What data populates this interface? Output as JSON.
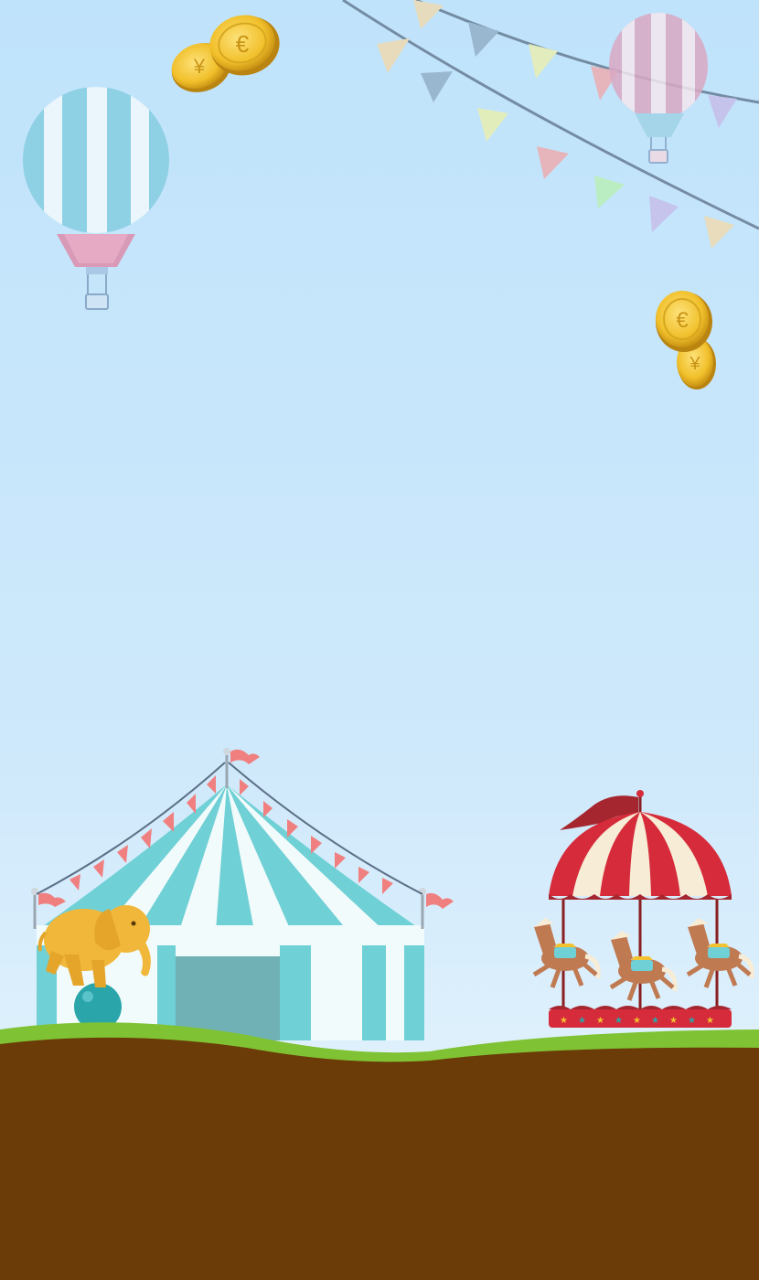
{
  "scene": {
    "title": "",
    "elements": {
      "left_balloon": "hot-air-balloon",
      "right_balloon": "hot-air-balloon",
      "coins_top": "gold-coins",
      "coins_right": "gold-coins",
      "bunting": "pennant-string",
      "circus_tent": "big-top-tent",
      "elephant": "elephant-on-ball",
      "carousel": "merry-go-round"
    }
  },
  "colors": {
    "sky_top": "#bfe3fb",
    "sky_bottom": "#e9f5fd",
    "grass": "#7fc233",
    "soil": "#6b3b08",
    "tent_teal": "#6fd0d6",
    "tent_white": "#f2fbfb",
    "tent_door": "#6fb1b4",
    "elephant": "#f0b73a",
    "ball": "#2aa5aa",
    "carousel_red": "#d62b3a",
    "carousel_cream": "#f7ecd6",
    "horse": "#c07a52",
    "pennant_pink": "#f08080",
    "coin_gold": "#f2c230"
  }
}
